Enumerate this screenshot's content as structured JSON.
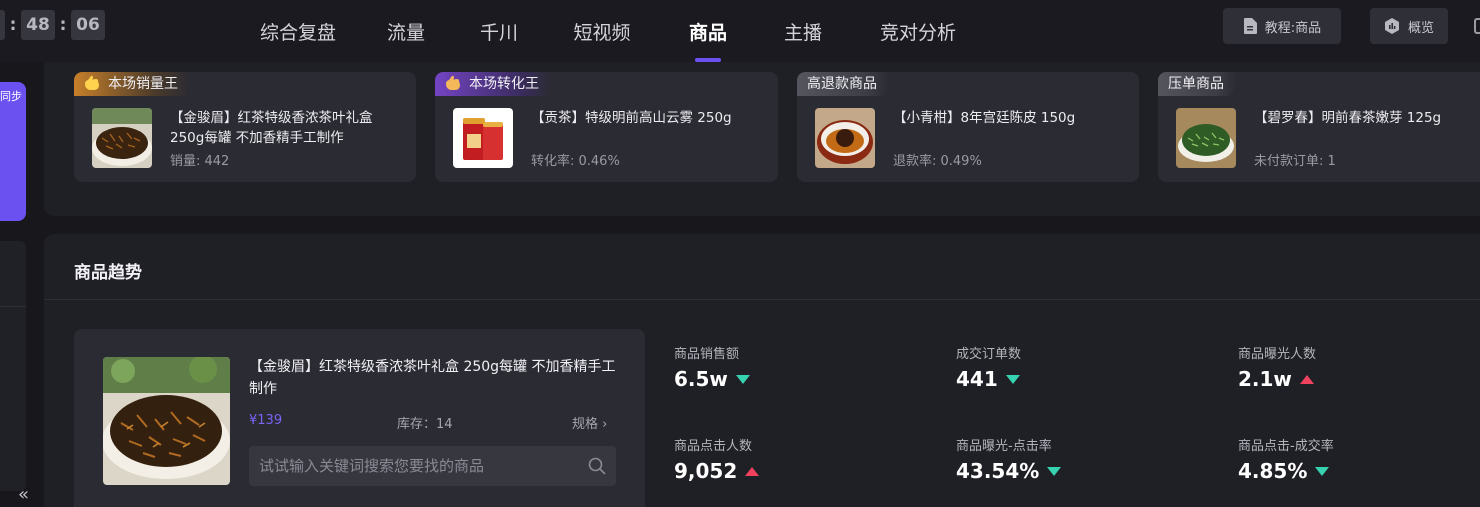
{
  "timer": {
    "hours_partial": "",
    "minutes": "48",
    "seconds": "06",
    "sep": ":"
  },
  "nav": [
    {
      "label": "综合复盘",
      "active": false
    },
    {
      "label": "流量",
      "active": false
    },
    {
      "label": "千川",
      "active": false
    },
    {
      "label": "短视频",
      "active": false
    },
    {
      "label": "商品",
      "active": true
    },
    {
      "label": "主播",
      "active": false
    },
    {
      "label": "竞对分析",
      "active": false
    }
  ],
  "toolbar": {
    "tutorial_label": "教程:商品",
    "overview_label": "概览"
  },
  "left": {
    "purple_tab_label": "同步"
  },
  "product_cards": [
    {
      "tag": "本场销量王",
      "tag_style": "gold",
      "name": "【金骏眉】红茶特级香浓茶叶礼盒250g每罐 不加香精手工制作",
      "stat": "销量: 442",
      "image_icon": "black-tea-image"
    },
    {
      "tag": "本场转化王",
      "tag_style": "purple",
      "name": "【贡茶】特级明前高山云雾 250g",
      "stat": "转化率: 0.46%",
      "image_icon": "tea-can-image"
    },
    {
      "tag": "高退款商品",
      "tag_style": "gray",
      "name": "【小青柑】8年宫廷陈皮 150g",
      "stat": "退款率: 0.49%",
      "image_icon": "tea-cup-image"
    },
    {
      "tag": "压单商品",
      "tag_style": "gray",
      "name": "【碧罗春】明前春茶嫩芽 125g",
      "stat": "未付款订单: 1",
      "image_icon": "green-tea-image"
    }
  ],
  "trend": {
    "title": "商品趋势",
    "product": {
      "name": "【金骏眉】红茶特级香浓茶叶礼盒 250g每罐 不加香精手工制作",
      "price": "¥139",
      "stock": "库存：14",
      "spec_label": "规格",
      "image_icon": "black-tea-image"
    },
    "search": {
      "placeholder": "试试输入关键词搜索您要找的商品",
      "value": ""
    },
    "metrics": [
      {
        "label": "商品销售额",
        "value": "6.5w",
        "trend": "down"
      },
      {
        "label": "成交订单数",
        "value": "441",
        "trend": "down"
      },
      {
        "label": "商品曝光人数",
        "value": "2.1w",
        "trend": "up"
      },
      {
        "label": "商品点击人数",
        "value": "9,052",
        "trend": "up"
      },
      {
        "label": "商品曝光-点击率",
        "value": "43.54%",
        "trend": "down"
      },
      {
        "label": "商品点击-成交率",
        "value": "4.85%",
        "trend": "down"
      }
    ]
  },
  "colors": {
    "accent": "#6b52f0",
    "down": "#37d2b0",
    "up": "#f0425f",
    "price": "#7b63f5"
  }
}
